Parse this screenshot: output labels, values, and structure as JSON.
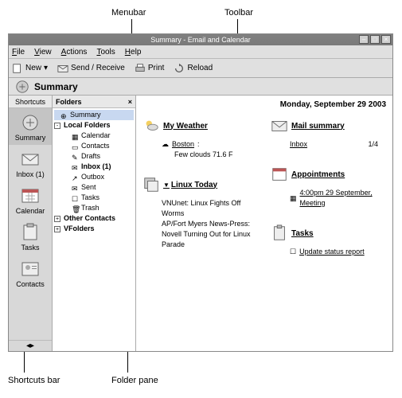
{
  "annotations": {
    "menubar": "Menubar",
    "toolbar": "Toolbar",
    "shortcuts": "Shortcuts bar",
    "folderpane": "Folder pane"
  },
  "titlebar": {
    "title": "Summary - Email and Calendar"
  },
  "menubar": {
    "file": "File",
    "view": "View",
    "actions": "Actions",
    "tools": "Tools",
    "help": "Help"
  },
  "toolbar": {
    "new": "New",
    "sendreceive": "Send / Receive",
    "print": "Print",
    "reload": "Reload"
  },
  "location": {
    "title": "Summary"
  },
  "shortcuts": {
    "header": "Shortcuts",
    "items": [
      {
        "label": "Summary",
        "selected": true
      },
      {
        "label": "Inbox (1)"
      },
      {
        "label": "Calendar"
      },
      {
        "label": "Tasks"
      },
      {
        "label": "Contacts"
      }
    ]
  },
  "folders": {
    "header": "Folders",
    "close": "×",
    "tree": {
      "summary": "Summary",
      "local": "Local Folders",
      "local_children": [
        "Calendar",
        "Contacts",
        "Drafts",
        "Inbox (1)",
        "Outbox",
        "Sent",
        "Tasks",
        "Trash"
      ],
      "other": "Other Contacts",
      "vfolders": "VFolders"
    }
  },
  "main": {
    "date": "Monday, September 29 2003",
    "weather": {
      "title": "My Weather",
      "city": "Boston",
      "cond": "Few clouds 71.6 F"
    },
    "news": {
      "title": "Linux Today",
      "items": "VNUnet: Linux Fights Off Worms\nAP/Fort Myers News-Press: Novell Turning Out for Linux Parade"
    },
    "mail": {
      "title": "Mail summary",
      "inbox_label": "Inbox",
      "inbox_count": "1/4"
    },
    "appt": {
      "title": "Appointments",
      "items": [
        {
          "text": "4:00pm 29 September, Meeting"
        }
      ]
    },
    "tasks": {
      "title": "Tasks",
      "items": [
        {
          "text": "Update status report"
        }
      ]
    }
  }
}
